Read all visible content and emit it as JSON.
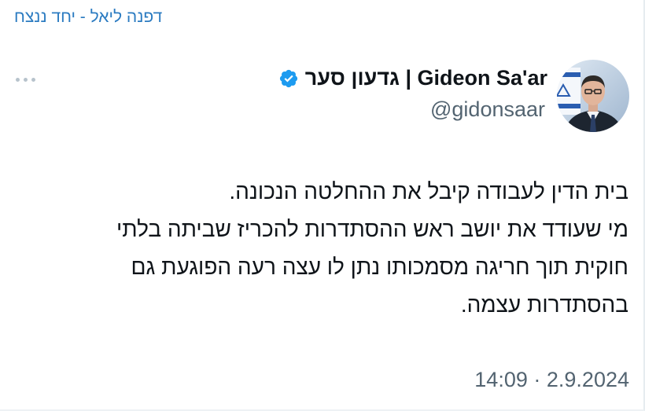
{
  "sender": {
    "name": "דפנה ליאל - יחד ננצח"
  },
  "tweet": {
    "author": {
      "display_name": "גדעון סער | Gideon Sa'ar",
      "handle": "@gidonsaar",
      "verified": true,
      "avatar_icon": "profile-photo"
    },
    "text_lines": [
      "בית הדין לעבודה קיבל את ההחלטה הנכונה.",
      "מי שעודד את יושב ראש ההסתדרות להכריז שביתה בלתי",
      "חוקית תוך חריגה מסמכותו נתן לו עצה רעה הפוגעת גם",
      "בהסתדרות עצמה."
    ],
    "time": "14:09",
    "separator": "·",
    "date": "2.9.2024"
  },
  "colors": {
    "sender_link": "#2b7bc1",
    "verified_badge": "#1d9bf0",
    "text_primary": "#0f1419",
    "text_secondary": "#536471"
  },
  "icons": {
    "more": "more-dots-icon",
    "verified": "verified-badge-icon"
  }
}
